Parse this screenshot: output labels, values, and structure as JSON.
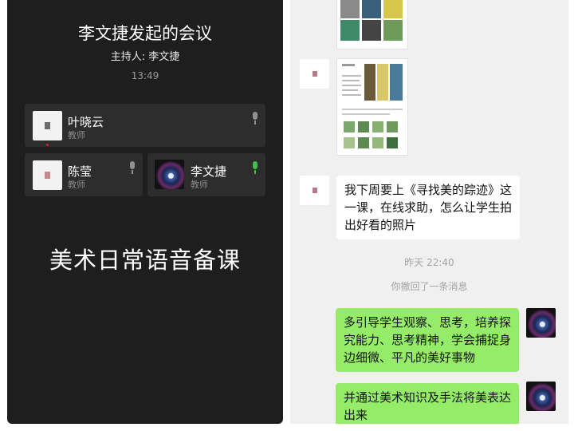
{
  "meeting": {
    "title": "李文捷发起的会议",
    "host": "主持人: 李文捷",
    "time": "13:49",
    "caption": "美术日常语音备课"
  },
  "participants": [
    {
      "name": "叶晓云",
      "role": "教师",
      "mic_active": false
    },
    {
      "name": "陈莹",
      "role": "教师",
      "mic_active": false
    },
    {
      "name": "李文捷",
      "role": "教师",
      "mic_active": true
    }
  ],
  "chat": {
    "messages": [
      {
        "from": "other",
        "text": "我下周要上《寻找美的踪迹》这一课，在线求助，怎么让学生拍出好看的照片"
      },
      {
        "from": "me",
        "text": "多引导学生观察、思考，培养探究能力、思考精神，学会捕捉身边细微、平凡的美好事物"
      },
      {
        "from": "me",
        "text": "并通过美术知识及手法将美表达出来"
      }
    ],
    "timestamp": "昨天 22:40",
    "recall_notice": "你撤回了一条消息"
  },
  "colors": {
    "left_bg": "#1e1e1e",
    "card_bg": "#2d2d2d",
    "chat_bg": "#f0f0f0",
    "my_bubble": "#95ec69",
    "mic_active": "#3fbf4a"
  }
}
